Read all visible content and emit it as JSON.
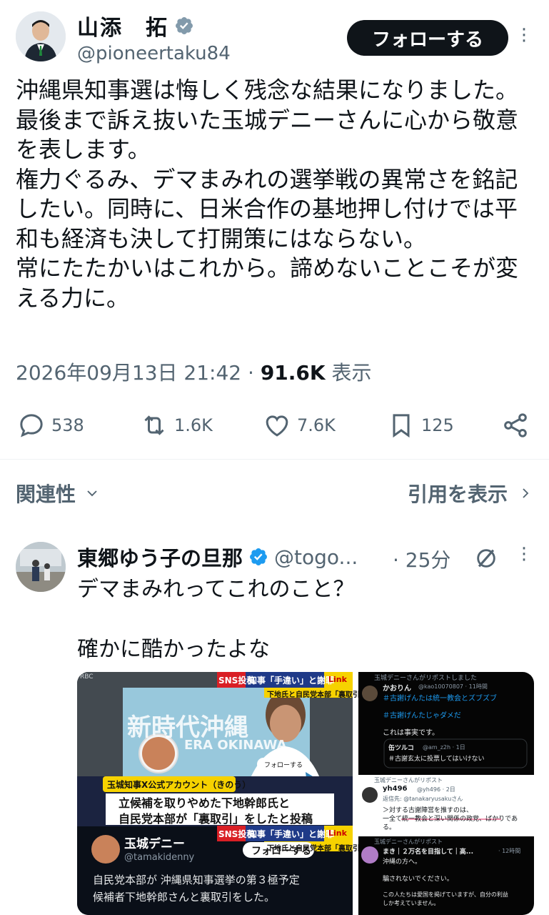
{
  "author": {
    "name": "山添　拓",
    "handle": "@pioneertaku84",
    "follow_label": "フォローする"
  },
  "post": {
    "text": "沖縄県知事選は悔しく残念な結果になりました。最後まで訴え抜いた玉城デニーさんに心から敬意を表します。\n権力ぐるみ、デマまみれの選挙戦の異常さを銘記したい。同時に、日米合作の基地押し付けでは平和も経済も決して打開策にはならない。\n常にたたかいはこれから。諦めないことこそが変える力に。",
    "timestamp": "2026年09月13日 21:42",
    "views": "91.6K",
    "views_label": "表示"
  },
  "actions": {
    "replies": "538",
    "reposts": "1.6K",
    "likes": "7.6K",
    "bookmarks": "125"
  },
  "sort": {
    "label": "関連性",
    "quotes_label": "引用を表示"
  },
  "reply": {
    "name": "東郷ゆう子の旦那",
    "handle": "@togo...",
    "time": "· 25分",
    "text": "デマまみれってこれのこと？\n\n確かに酷かったよな"
  },
  "media_left": {
    "corner_label": "RBC",
    "sns_badge": "SNS投稿",
    "headline_badge": "知事「手違い」と謝罪",
    "link_badge": "Link",
    "sub_badge": "下地氏と自民党本部「裏取引」",
    "banner_jp": "新時代沖縄",
    "banner_en": "ERA OKINAWA",
    "follow_chip": "フォローする",
    "source_caption": "玉城知事X公式アカウント（きのう）",
    "caption_line1": "立候補を取りやめた下地幹郎氏と",
    "caption_line2": "自民党本部が「裏取引」をしたと投稿",
    "profile_name": "玉城デニー",
    "profile_handle": "@tamakidenny",
    "profile_follow": "フォローする",
    "profile_text1": "自民党本部が 沖縄県知事選挙の第３極予定",
    "profile_text2": "候補者下地幹郎さんと裏取引をした。"
  },
  "media_right": {
    "repost_label1": "玉城デニーさんがリポストしました",
    "t1_name": "かおりん",
    "t1_handle": "@kao10070807 · 11時間",
    "t1_line1": "＃古謝げんたは統一教会とズブズブ",
    "t1_line2": "＃古謝げんたじゃダメだ",
    "t1_line3": "これは事実です。",
    "t1_quote_name": "缶ツルコ",
    "t1_quote_handle": "@am_z2h · 1日",
    "t1_quote_text": "＃古謝玄太に投票してはいけない",
    "repost_label2": "玉城デニーさんがリポスト",
    "t2_name": "yh496",
    "t2_handle": "@yh496 · 2日",
    "t2_reply_to": "返信先: @tanakaryusakuさん",
    "t2_line1": "＞対する古謝陣営を推すのは、",
    "t2_line2": "一全て統一教会と深い関係の政党、ばかりであ",
    "t2_line3": "る。",
    "repost_label3": "玉城デニーさんがリポスト",
    "t3_name": "まき｜２万名を目指して｜高...",
    "t3_handle": "· 12時間",
    "t3_line1": "沖縄の方へ。",
    "t3_line2": "騙されないでください。",
    "t3_line3": "この人たちは愛国を掲げていますが、自分の利益",
    "t3_line4": "しか考えていません。"
  }
}
